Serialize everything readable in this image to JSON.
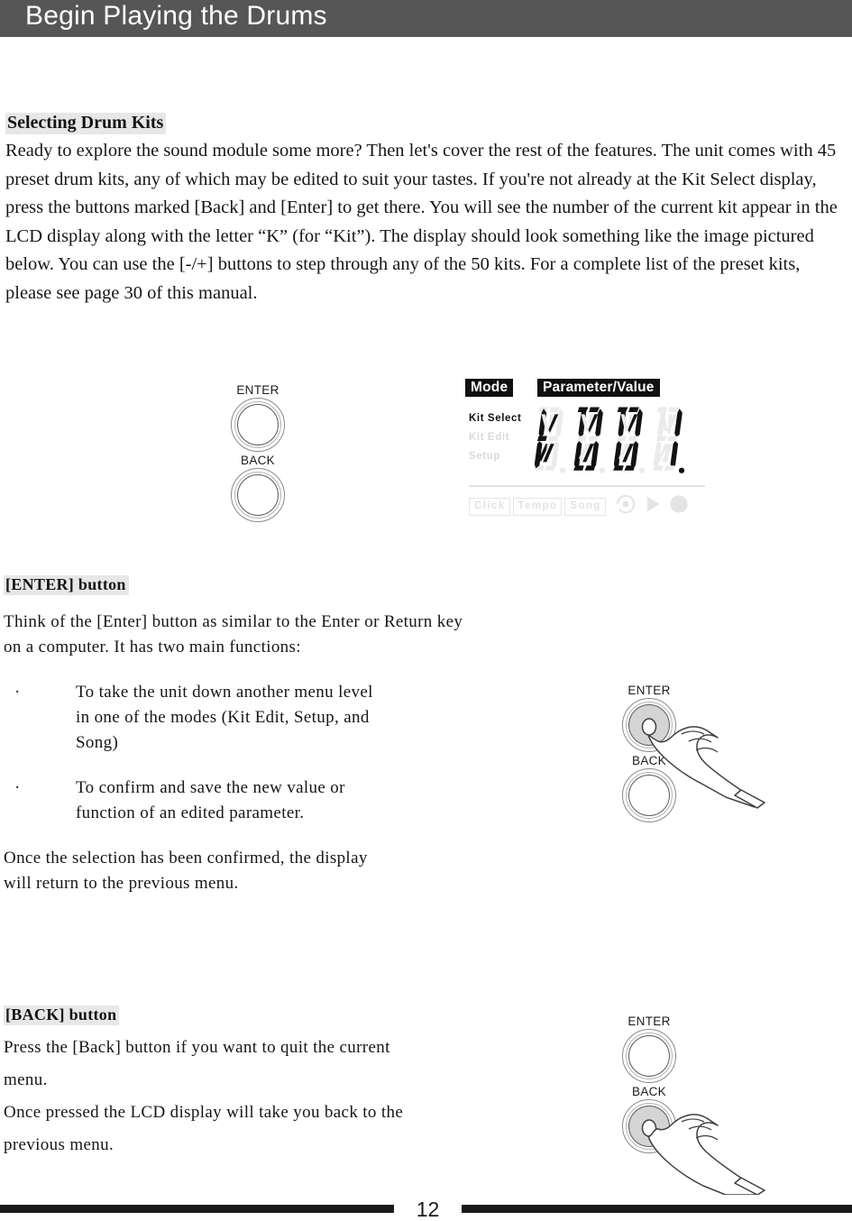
{
  "header": {
    "title": "Begin Playing the Drums"
  },
  "sections": {
    "kits": {
      "heading": "Selecting Drum Kits",
      "paragraph": "Ready to explore the sound module some more? Then let's cover the rest of the features. The unit comes with 45 preset drum kits, any of which may be edited to suit your tastes. If you're not already at the Kit Select display, press the buttons marked [Back] and [Enter] to get there. You will see the number of the current kit appear in the LCD display along with the letter “K” (for “Kit”). The display should look something like the image pictured below. You can use the [-/+] buttons to step through any of the 50 kits. For a complete list of the preset kits, please see page 30 of this manual."
    },
    "enter": {
      "heading": "[ENTER] button",
      "intro_line1": "Think of the [Enter] button as similar to the Enter or Return key",
      "intro_line2": "on a computer. It has two main functions:",
      "bullets": [
        {
          "marker": "·",
          "line1": "To take the unit down another menu level",
          "line2": "in one of the modes (Kit Edit, Setup, and",
          "line3": "Song)"
        },
        {
          "marker": "·",
          "line1": "To confirm and save the new value or",
          "line2": "function of an edited  parameter.",
          "line3": ""
        }
      ],
      "outro_line1": "Once the selection has been confirmed, the display",
      "outro_line2": "will return to the previous menu."
    },
    "back": {
      "heading": "[BACK] button",
      "para1_line1": "Press the [Back] button if you want to quit the current",
      "para1_line2": "menu.",
      "para2_line1": "Once pressed the LCD display will take you back to the",
      "para2_line2": "previous menu."
    }
  },
  "buttons": {
    "enter_label": "ENTER",
    "back_label": "BACK"
  },
  "lcd": {
    "tag_mode": "Mode",
    "tag_parameter": "Parameter/Value",
    "modes": [
      {
        "label": "Kit Select",
        "state": "active"
      },
      {
        "label": "Kit Edit",
        "state": "inactive"
      },
      {
        "label": "Setup",
        "state": "inactive"
      }
    ],
    "value": "K001",
    "digits": [
      {
        "char": "K",
        "segments": [
          "f",
          "e",
          "g1",
          "j",
          "k",
          "m"
        ],
        "dp": false
      },
      {
        "char": "0",
        "segments": [
          "a1",
          "a2",
          "b",
          "c",
          "d1",
          "d2",
          "e",
          "f",
          "j",
          "m"
        ],
        "dp": false
      },
      {
        "char": "0",
        "segments": [
          "a1",
          "a2",
          "b",
          "c",
          "d1",
          "d2",
          "e",
          "f",
          "j",
          "m"
        ],
        "dp": false
      },
      {
        "char": "1",
        "segments": [
          "b",
          "c"
        ],
        "dp": true
      }
    ],
    "bottom_chips": [
      "Click",
      "Tempo",
      "Song"
    ],
    "transport_icons": [
      "record-icon",
      "play-icon",
      "stop-icon"
    ],
    "colors": {
      "segment_on": "#121212",
      "segment_off": "#ebebeb",
      "tag_bg": "#101010",
      "tag_text": "#ffffff",
      "mode_active": "#111111",
      "mode_inactive": "#d8d8d8"
    }
  },
  "illustrations": {
    "enter_press": {
      "enter_label": "ENTER",
      "back_label": "BACK",
      "pressed": "enter"
    },
    "back_press": {
      "enter_label": "ENTER",
      "back_label": "BACK",
      "pressed": "back"
    }
  },
  "footer": {
    "page_number": "12"
  },
  "colors": {
    "header_bar": "#565656",
    "heading_highlight": "#e7e7e7",
    "body_text": "#161616",
    "footer_rule": "#1a1a1a"
  }
}
